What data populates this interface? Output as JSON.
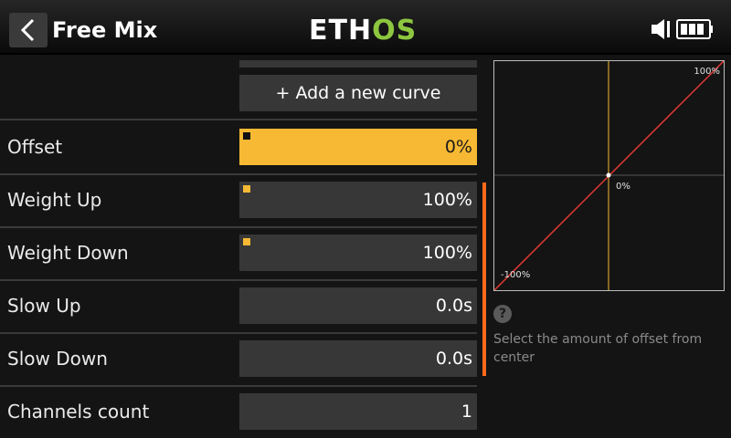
{
  "header": {
    "title": "Free Mix",
    "logo_part1": "ETH",
    "logo_part2": "OS"
  },
  "add_curve_label": "+ Add a new curve",
  "rows": [
    {
      "label": "Offset",
      "value": "0%",
      "selected": true,
      "marker": true
    },
    {
      "label": "Weight Up",
      "value": "100%",
      "selected": false,
      "marker": true
    },
    {
      "label": "Weight Down",
      "value": "100%",
      "selected": false,
      "marker": true
    },
    {
      "label": "Slow Up",
      "value": "0.0s",
      "selected": false,
      "marker": false
    },
    {
      "label": "Slow Down",
      "value": "0.0s",
      "selected": false,
      "marker": false
    },
    {
      "label": "Channels count",
      "value": "1",
      "selected": false,
      "marker": false
    }
  ],
  "graph": {
    "label_top": "100%",
    "label_center": "0%",
    "label_bottom": "-100%"
  },
  "help": {
    "icon": "?",
    "text": "Select the amount of offset from center"
  },
  "colors": {
    "accent": "#f7b933",
    "scrollbar": "#ff6a1a",
    "curve": "#e53935",
    "logo_green": "#8dc63f"
  },
  "icons": {
    "back": "back-arrow-icon",
    "speaker": "speaker-icon",
    "battery": "battery-icon"
  }
}
